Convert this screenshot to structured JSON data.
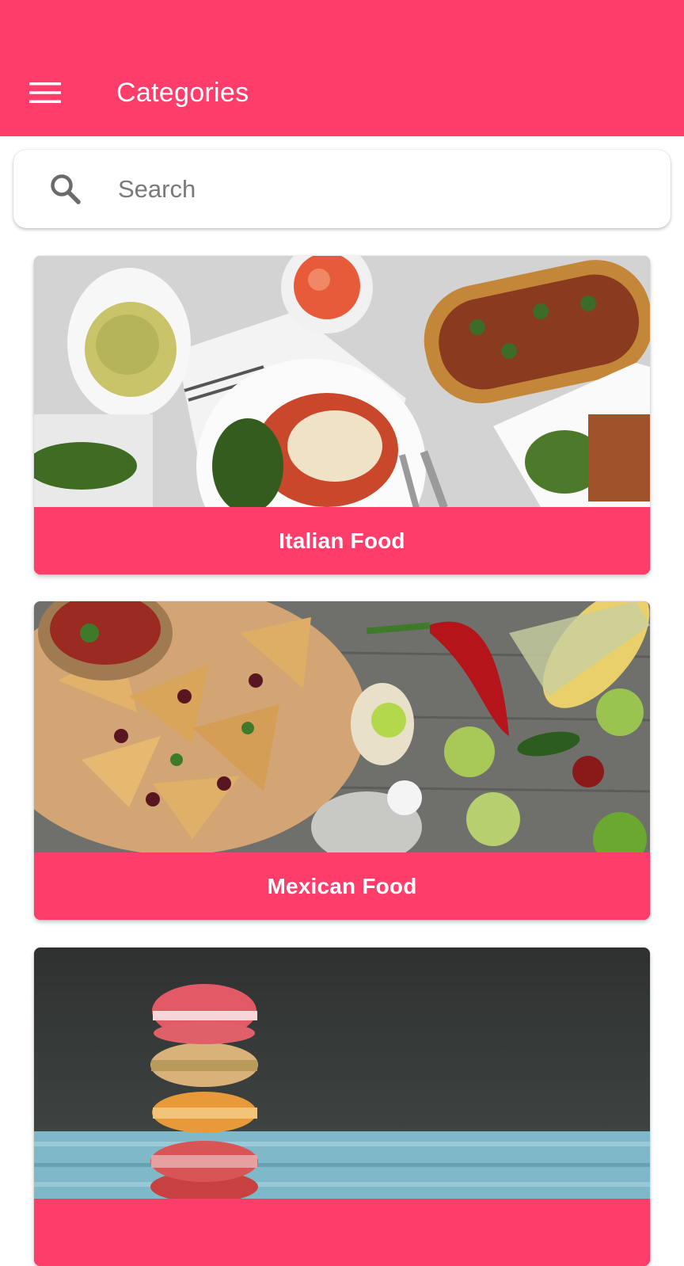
{
  "appbar": {
    "title": "Categories",
    "menu_icon": "hamburger-menu-icon",
    "color": "#ff3d6b"
  },
  "search": {
    "placeholder": "Search",
    "value": "",
    "icon": "search-icon"
  },
  "categories": [
    {
      "label": "Italian Food",
      "image": "italian-food-photo"
    },
    {
      "label": "Mexican Food",
      "image": "mexican-food-photo"
    },
    {
      "label": "",
      "image": "macarons-dessert-photo"
    }
  ]
}
